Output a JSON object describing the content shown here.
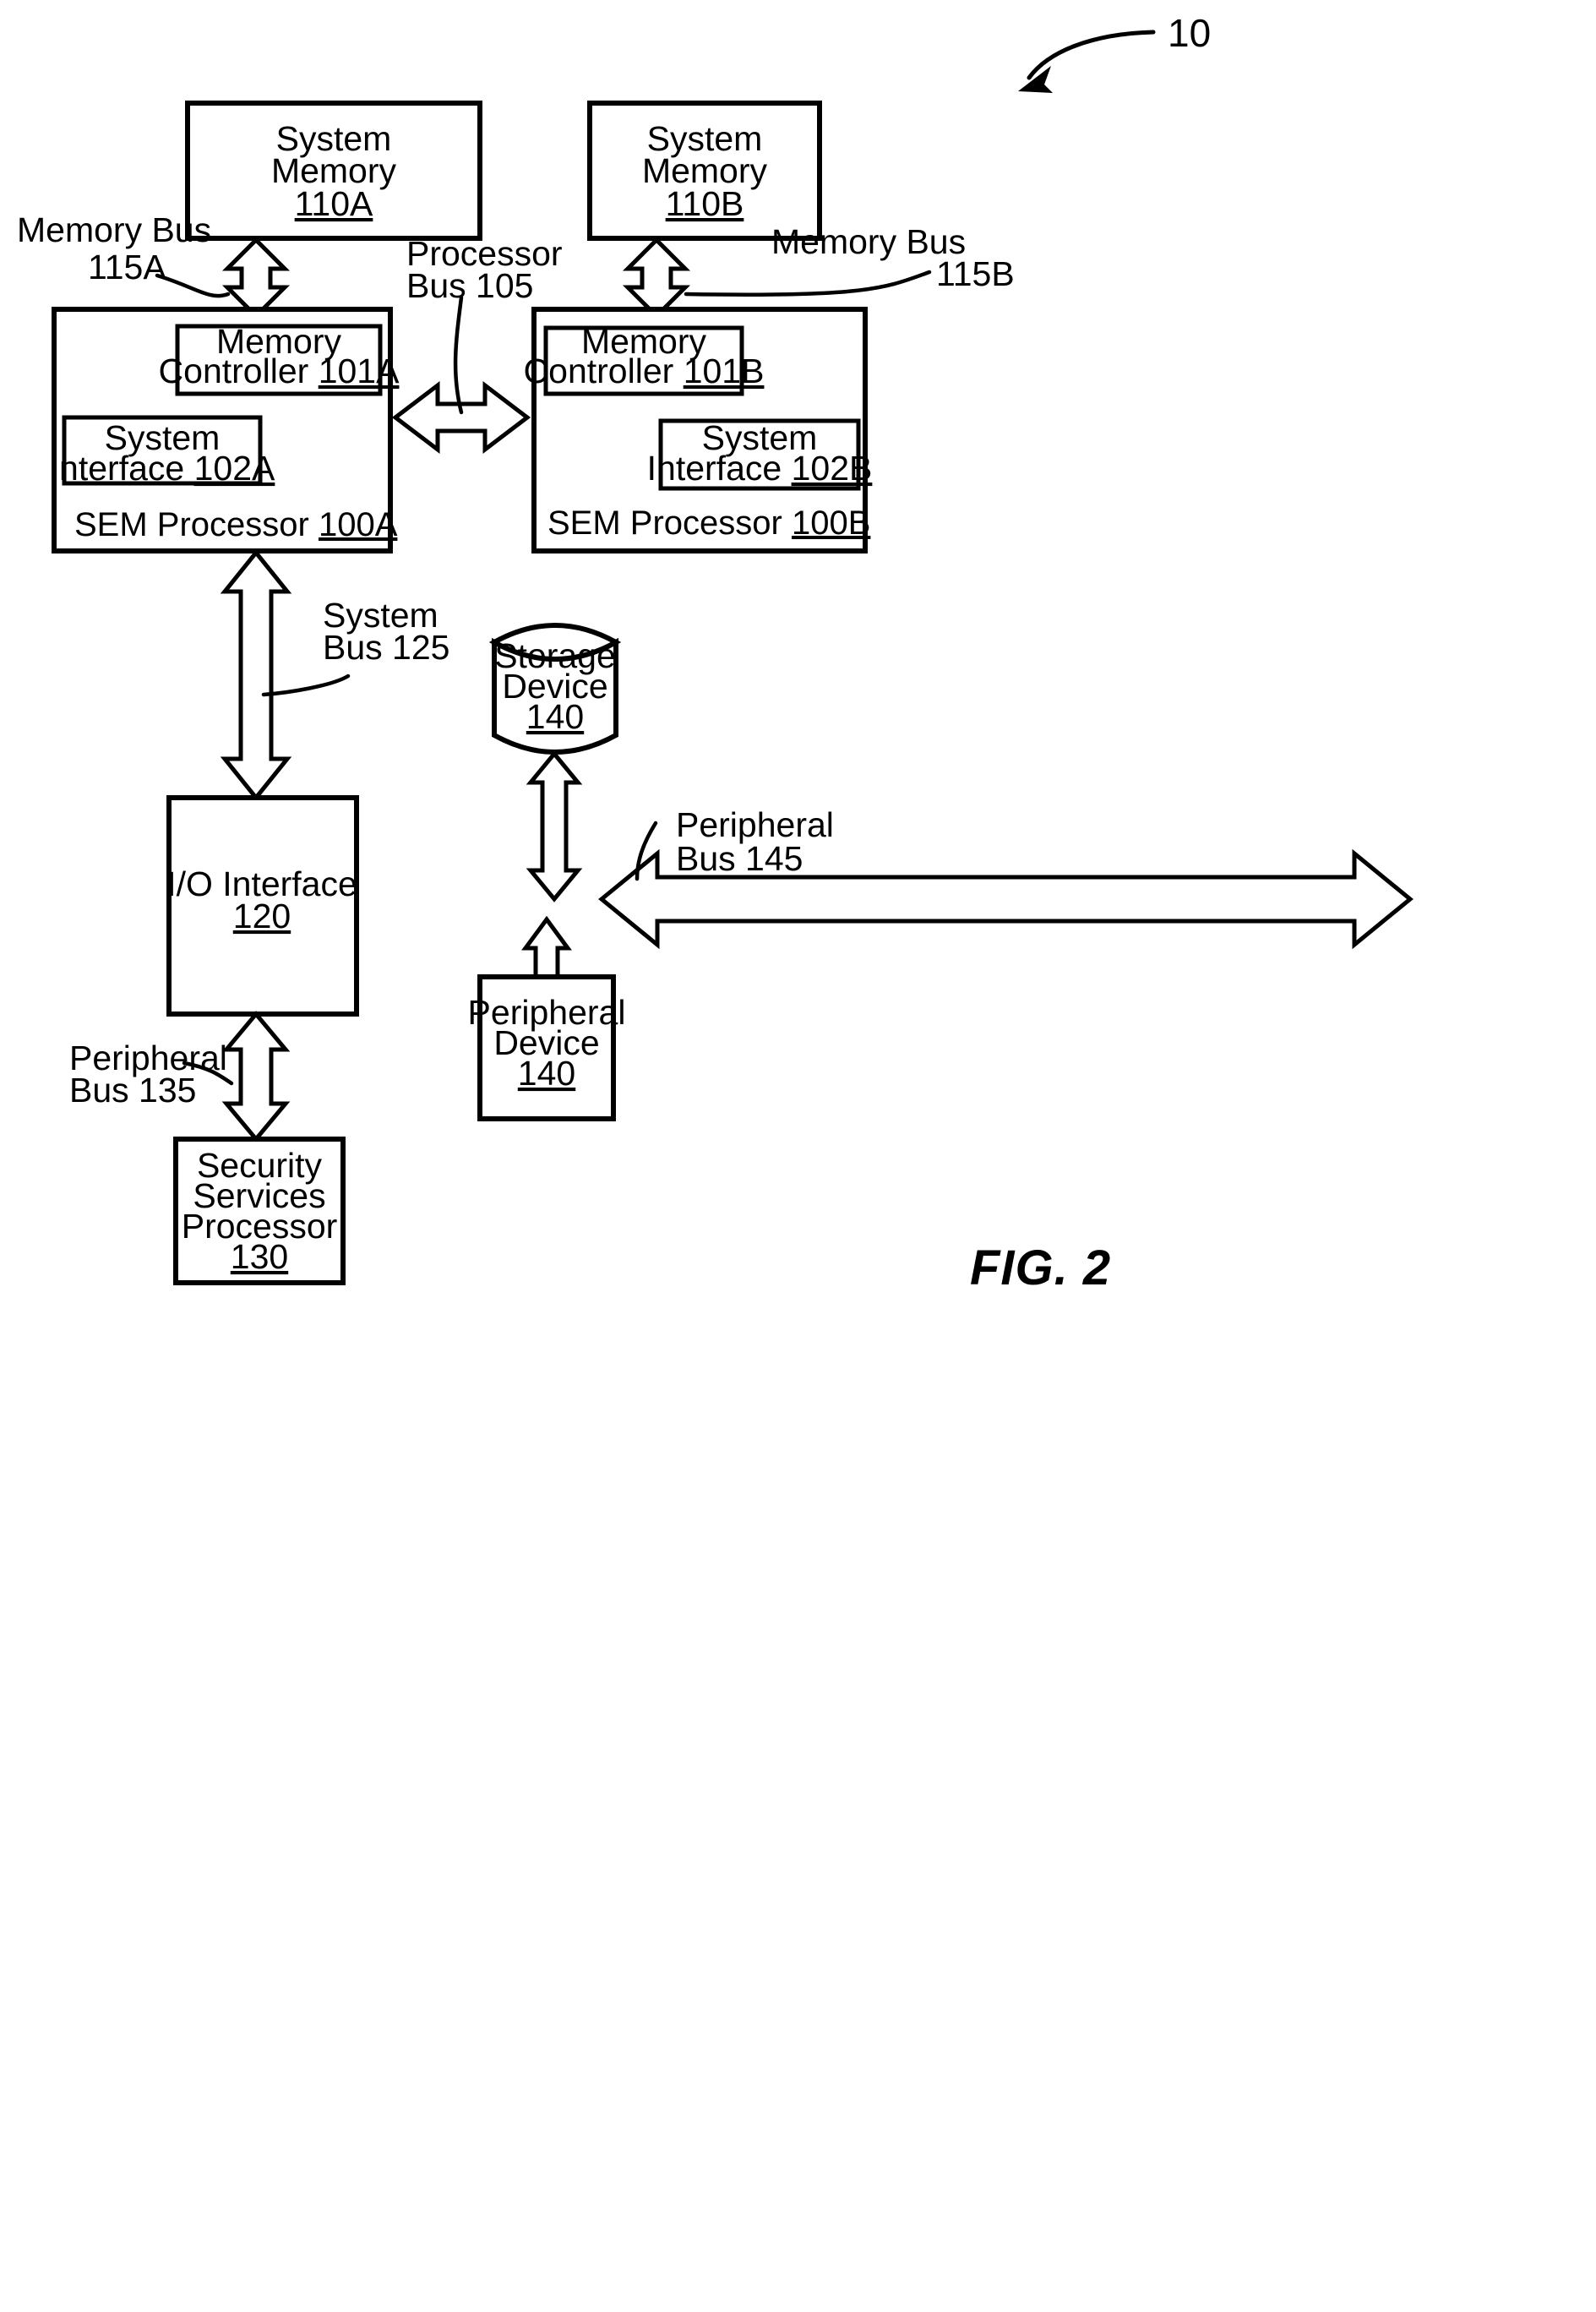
{
  "figure": {
    "caption": "FIG. 2",
    "system_reference": "10"
  },
  "blocks": [
    {
      "id": "system-memory-a",
      "lines": [
        "System",
        "Memory"
      ],
      "ref": "110A"
    },
    {
      "id": "system-memory-b",
      "lines": [
        "System",
        "Memory"
      ],
      "ref": "110B"
    },
    {
      "id": "sem-processor-a",
      "lines": [
        "SEM Processor"
      ],
      "ref": "100A"
    },
    {
      "id": "sem-processor-b",
      "lines": [
        "SEM Processor"
      ],
      "ref": "100B"
    },
    {
      "id": "memory-controller-a",
      "lines": [
        "Memory",
        "Controller"
      ],
      "ref": "101A"
    },
    {
      "id": "memory-controller-b",
      "lines": [
        "Memory",
        "Controller"
      ],
      "ref": "101B"
    },
    {
      "id": "system-interface-a",
      "lines": [
        "System",
        "Interface"
      ],
      "ref": "102A"
    },
    {
      "id": "system-interface-b",
      "lines": [
        "System",
        "Interface"
      ],
      "ref": "102B"
    },
    {
      "id": "io-interface",
      "lines": [
        "I/O Interface"
      ],
      "ref": "120"
    },
    {
      "id": "security-services-processor",
      "lines": [
        "Security",
        "Services",
        "Processor"
      ],
      "ref": "130"
    },
    {
      "id": "storage-device",
      "lines": [
        "Storage",
        "Device"
      ],
      "ref": "140"
    },
    {
      "id": "peripheral-device",
      "lines": [
        "Peripheral",
        "Device"
      ],
      "ref": "140"
    }
  ],
  "labels": {
    "memory_bus_a": {
      "line1": "Memory Bus",
      "line2": "115A"
    },
    "memory_bus_b": {
      "line1": "Memory Bus",
      "line2": "115B"
    },
    "processor_bus": {
      "line1": "Processor",
      "line2": "Bus 105"
    },
    "system_bus": {
      "line1": "System",
      "line2": "Bus 125"
    },
    "peripheral_bus_135": {
      "line1": "Peripheral",
      "line2": "Bus 135"
    },
    "peripheral_bus_145": {
      "line1": "Peripheral",
      "line2": "Bus 145"
    }
  },
  "text_pieces": {
    "sm_a_l1": "System",
    "sm_a_l2": "Memory",
    "sm_a_ref": "110A",
    "sm_b_l1": "System",
    "sm_b_l2": "Memory",
    "sm_b_ref": "110B",
    "mc_a_l1": "Memory",
    "mc_a_l2": "Controller",
    "mc_a_ref": "101A",
    "mc_b_l1": "Memory",
    "mc_b_l2": "Controller",
    "mc_b_ref": "101B",
    "si_a_l1": "System",
    "si_a_l2": "Interface",
    "si_a_ref": "102A",
    "si_b_l1": "System",
    "si_b_l2": "Interface",
    "si_b_ref": "102B",
    "sem_a_name": "SEM Processor",
    "sem_a_ref": "100A",
    "sem_b_name": "SEM Processor",
    "sem_b_ref": "100B",
    "io_name": "I/O Interface",
    "io_ref": "120",
    "ssp_l1": "Security",
    "ssp_l2": "Services",
    "ssp_l3": "Processor",
    "ssp_ref": "130",
    "storage_l1": "Storage",
    "storage_l2": "Device",
    "storage_ref": "140",
    "periph_l1": "Peripheral",
    "periph_l2": "Device",
    "periph_ref": "140",
    "membus_a_l1": "Memory Bus",
    "membus_a_l2": "115A",
    "membus_b_l1": "Memory Bus",
    "membus_b_l2": "115B",
    "procbus_l1": "Processor",
    "procbus_l2": "Bus 105",
    "sysbus_l1": "System",
    "sysbus_l2": "Bus 125",
    "pbus135_l1": "Peripheral",
    "pbus135_l2": "Bus 135",
    "pbus145_l1": "Peripheral",
    "pbus145_l2": "Bus 145",
    "ref_10": "10",
    "fig_caption": "FIG. 2"
  },
  "colors": {
    "stroke": "#000000",
    "fill": "#ffffff",
    "background": "#ffffff"
  }
}
